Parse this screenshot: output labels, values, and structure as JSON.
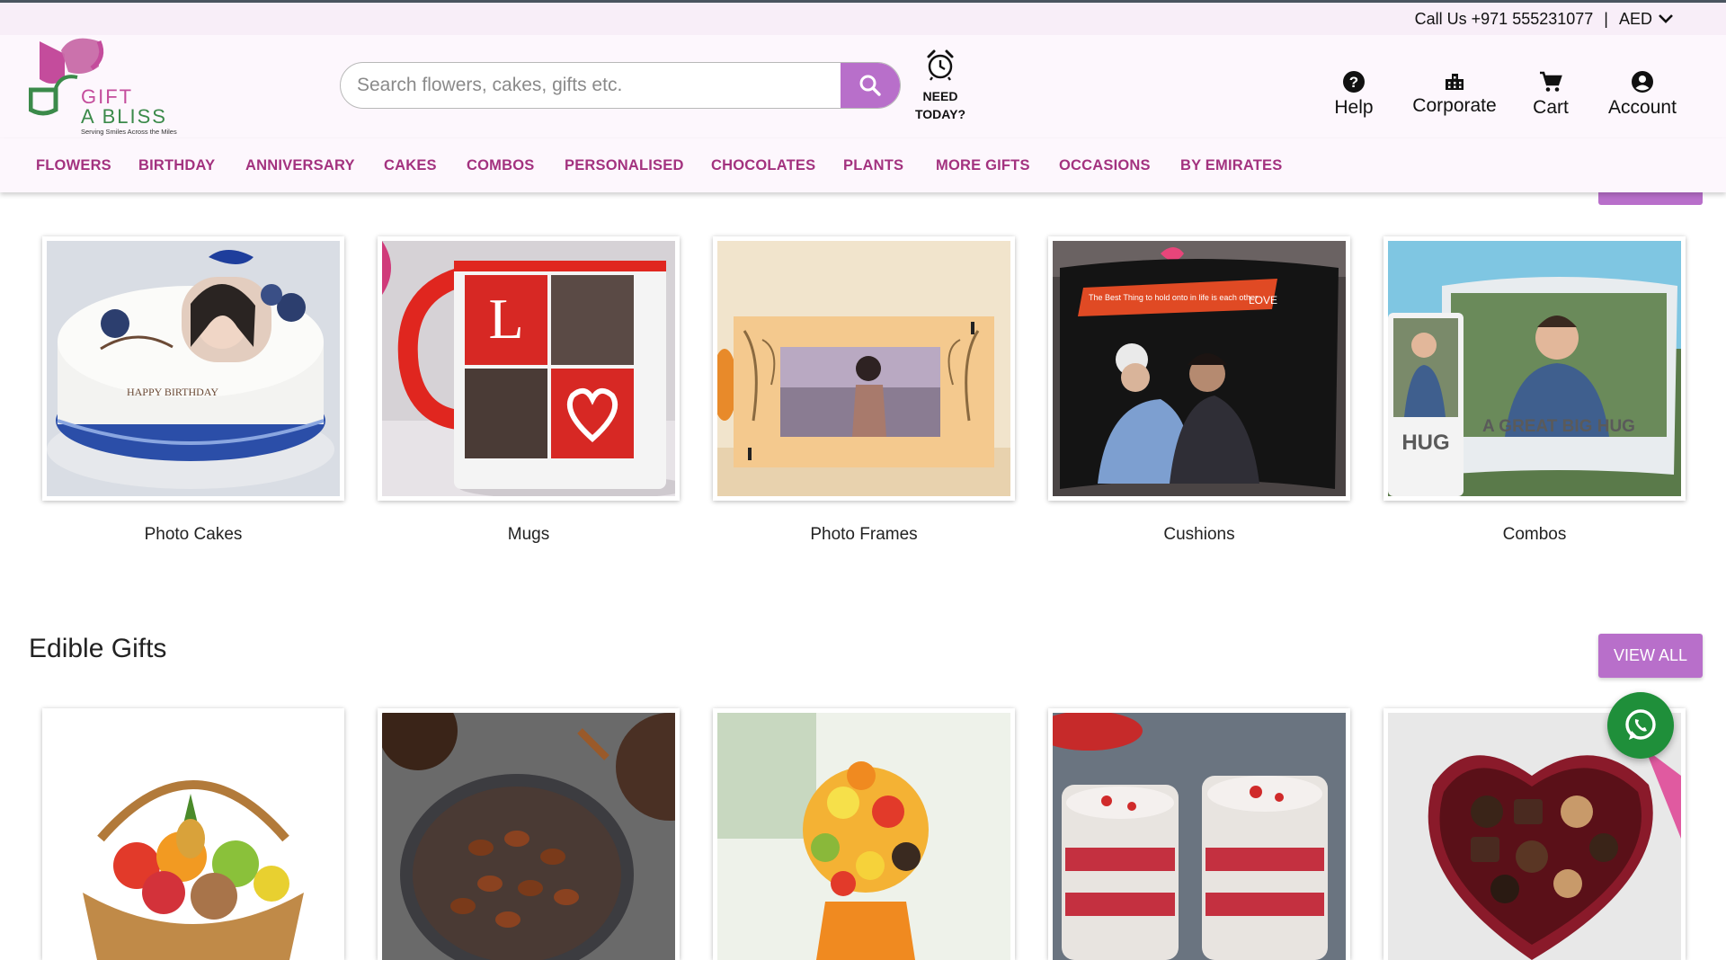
{
  "topbar": {
    "contact": "Call Us +971 555231077",
    "separator": "|",
    "currency": "AED"
  },
  "logo": {
    "line1": "GIFT",
    "line2": "A BLISS",
    "tagline": "Serving Smiles Across the Miles"
  },
  "search": {
    "placeholder": "Search flowers, cakes, gifts etc."
  },
  "need_today": {
    "line1": "NEED",
    "line2": "TODAY?"
  },
  "header_links": [
    {
      "label": "Help",
      "icon": "help-icon"
    },
    {
      "label": "Corporate",
      "icon": "building-icon"
    },
    {
      "label": "Cart",
      "icon": "cart-icon"
    },
    {
      "label": "Account",
      "icon": "account-icon"
    }
  ],
  "nav": [
    "FLOWERS",
    "BIRTHDAY",
    "ANNIVERSARY",
    "CAKES",
    "COMBOS",
    "PERSONALISED",
    "CHOCOLATES",
    "PLANTS",
    "MORE GIFTS",
    "OCCASIONS",
    "BY EMIRATES"
  ],
  "personalised": {
    "items": [
      "Photo Cakes",
      "Mugs",
      "Photo Frames",
      "Cushions",
      "Combos"
    ],
    "image_text": {
      "cake": "HAPPY BIRTHDAY",
      "mug": "L",
      "cushion_quote": "The Best Thing to hold onto in life is each other",
      "cushion_love": "LOVE",
      "combo_mug": "HUG",
      "combo_cushion": "A GREAT BIG HUG"
    }
  },
  "edible": {
    "title": "Edible Gifts",
    "view_all": "VIEW ALL"
  },
  "colors": {
    "brand_purple": "#b86fca",
    "nav_text": "#a3327f",
    "whatsapp": "#1f8f3a"
  }
}
